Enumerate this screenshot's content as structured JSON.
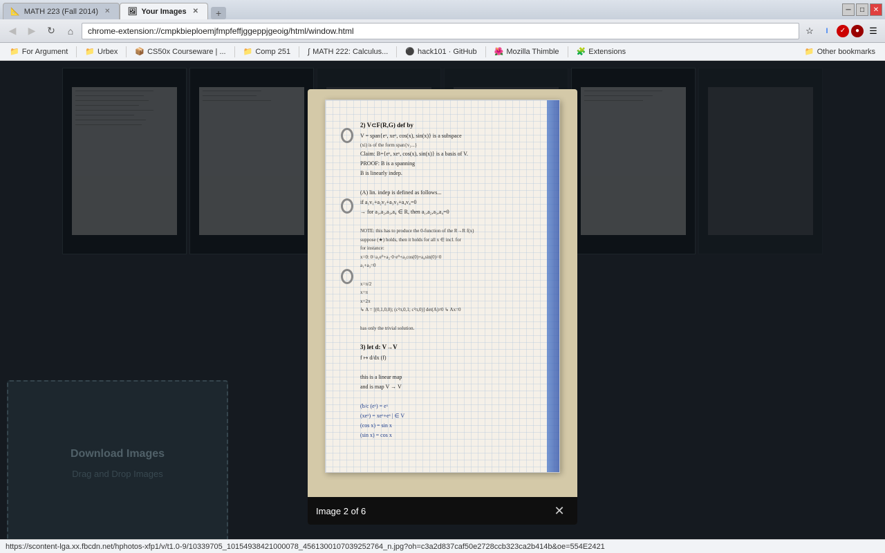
{
  "browser": {
    "tabs": [
      {
        "id": "tab1",
        "label": "MATH 223 (Fall 2014)",
        "favicon": "📐",
        "active": false
      },
      {
        "id": "tab2",
        "label": "Your Images",
        "favicon": "🖼",
        "active": true
      }
    ],
    "new_tab_icon": "+",
    "window_controls": [
      "─",
      "□",
      "✕"
    ],
    "address": "chrome-extension://cmpkbieploemjfmpfeffjggeppjgeoig/html/window.html",
    "nav_icons": [
      "★",
      "I",
      "S",
      "☰"
    ],
    "reload_icon": "↻",
    "back_icon": "←",
    "forward_icon": "→",
    "home_icon": "⌂"
  },
  "bookmarks": [
    {
      "label": "For Argument",
      "icon": "📁"
    },
    {
      "label": "Urbex",
      "icon": "📁"
    },
    {
      "label": "CS50x Courseware | ...",
      "icon": "📦"
    },
    {
      "label": "Comp 251",
      "icon": "📁"
    },
    {
      "label": "MATH 222: Calculus...",
      "icon": "∫"
    },
    {
      "label": "hack101 · GitHub",
      "icon": ""
    },
    {
      "label": "Mozilla Thimble",
      "icon": "🌺"
    },
    {
      "label": "Extensions",
      "icon": "🧩"
    },
    {
      "label": "Other bookmarks",
      "icon": "📁"
    }
  ],
  "page": {
    "title": "Your Images",
    "download_section": {
      "title": "Download Images",
      "subtitle": "Drag and Drop Images"
    }
  },
  "lightbox": {
    "caption": "Image 2 of 6",
    "close_label": "✕",
    "notebook_lines": [
      "2) V⊂F(R,G) def by",
      "   V = span{e^x, xe^x, cos(x), sin(x)} is a subspace",
      "   (xi) is of the form span{v₁...}",
      "   Claim: B={e^x, xe^x, cos(x), sin(x)} is a basis of V.",
      "PROOF: B is a spanning",
      "       B is linearly indep.",
      "",
      "  (A) lin. indep is defined as follows...",
      "      if a₁v₁+a₂v₂+a₃v₃+a₄v₄=0",
      "      → for a₁,a₂,a₃,a₄ ∈ R, then a₁,a₂,a₃,a₄=0",
      "",
      "NOTE: this has to produce the 0-function of the R→R f(x)",
      "      suppose (★) holds, then it holds for all x ∈ incl. for",
      "      for instance:        a₁",
      "      x=0:  0 = a₁e⁰+a₂e⁰·0+a₃cos(0)+a₄sin(0) = 0",
      "            a₁+a₃=0",
      "",
      "      x=π/2",
      "      x=π",
      "      x=2π",
      "         ↳ A = [(0,1,0,0); (c²π,0,1; c²π,0)] det(A)≠0",
      "                                              ↳ Ax=0",
      "",
      "                           has only the trivial solution.",
      "",
      "3) let d: V→V",
      "   f↦ d/dx (f)",
      "",
      "   this is a linear map",
      "   and is map V → V",
      "",
      "   (b/c  (e^x) = e^x",
      "         (xe^x) = xe^x+e^x     | ∈ V",
      "         (cos x) = sin x",
      "         (sin x) = cos x"
    ]
  },
  "status_bar": {
    "url": "https://scontent-lga.xx.fbcdn.net/hphotos-xfp1/v/t1.0-9/10339705_10154938421000078_4561300107039252764_n.jpg?oh=c3a2d837caf50e2728ccb323ca2b414b&oe=554E2421"
  }
}
